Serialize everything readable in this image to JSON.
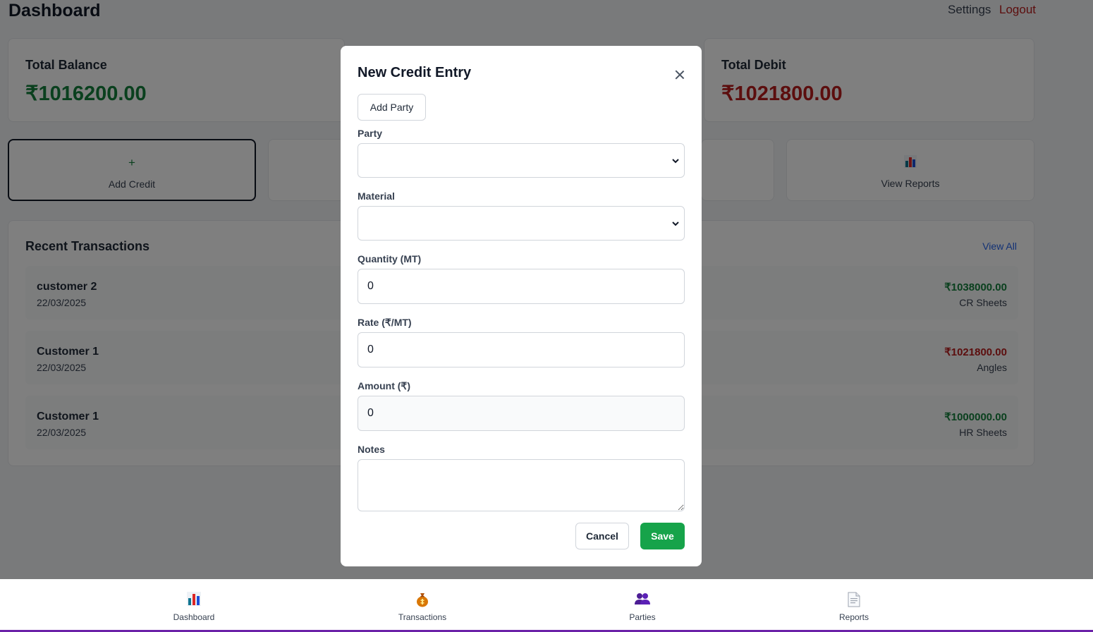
{
  "header": {
    "title": "Dashboard",
    "settings_label": "Settings",
    "logout_label": "Logout"
  },
  "stats": {
    "total_balance": {
      "label": "Total Balance",
      "value": "₹1016200.00",
      "color": "#15803d"
    },
    "total_debit": {
      "label": "Total Debit",
      "value": "₹1021800.00",
      "color": "#b91c1c"
    }
  },
  "actions": [
    {
      "icon": "+",
      "label": "Add Credit",
      "icon_name": "plus-icon"
    },
    {
      "icon": "",
      "label": "",
      "icon_name": ""
    },
    {
      "icon": "",
      "label": "",
      "icon_name": ""
    },
    {
      "icon": "",
      "label": "View Reports",
      "icon_name": "bar-chart-icon"
    }
  ],
  "recent": {
    "title": "Recent Transactions",
    "view_all_label": "View All",
    "transactions": [
      {
        "name": "customer 2",
        "date": "22/03/2025",
        "amount": "₹1038000.00",
        "material": "CR Sheets",
        "type": "credit"
      },
      {
        "name": "Customer 1",
        "date": "22/03/2025",
        "amount": "₹1021800.00",
        "material": "Angles",
        "type": "debit"
      },
      {
        "name": "Customer 1",
        "date": "22/03/2025",
        "amount": "₹1000000.00",
        "material": "HR Sheets",
        "type": "credit"
      }
    ]
  },
  "modal": {
    "title": "New Credit Entry",
    "add_party_label": "Add Party",
    "fields": {
      "party": {
        "label": "Party",
        "value": ""
      },
      "material": {
        "label": "Material",
        "value": ""
      },
      "quantity": {
        "label": "Quantity (MT)",
        "value": "0"
      },
      "rate": {
        "label": "Rate (₹/MT)",
        "value": "0"
      },
      "amount": {
        "label": "Amount (₹)",
        "value": "0"
      },
      "notes": {
        "label": "Notes",
        "value": ""
      }
    },
    "cancel_label": "Cancel",
    "save_label": "Save"
  },
  "bottom_nav": [
    {
      "label": "Dashboard",
      "icon_name": "bar-chart-icon"
    },
    {
      "label": "Transactions",
      "icon_name": "money-bag-icon"
    },
    {
      "label": "Parties",
      "icon_name": "people-icon"
    },
    {
      "label": "Reports",
      "icon_name": "document-icon"
    }
  ],
  "colors": {
    "credit": "#15803d",
    "debit": "#b91c1c",
    "save": "#16a34a",
    "link": "#2563eb"
  }
}
